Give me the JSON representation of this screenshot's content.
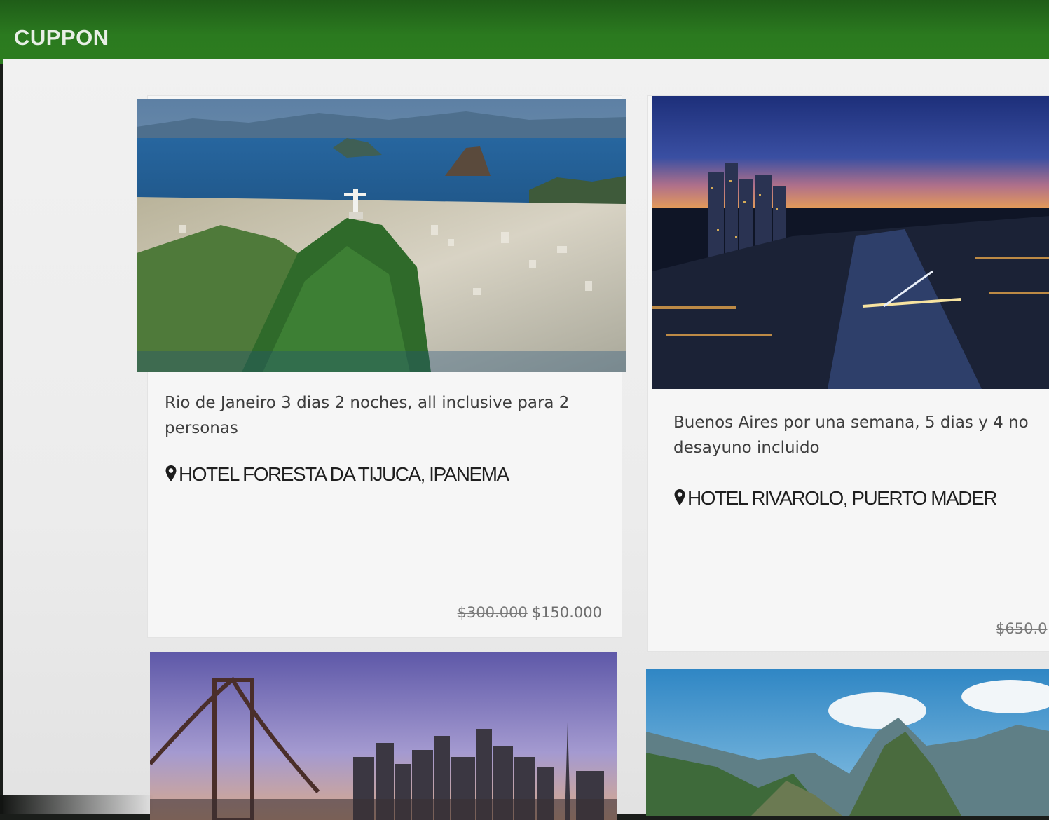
{
  "app": {
    "brand": "CUPPON"
  },
  "cards": [
    {
      "description": "Rio de Janeiro 3 dias 2 noches, all inclusive para 2 personas",
      "location": "HOTEL FORESTA DA TIJUCA, IPANEMA",
      "price_old": "$300.000",
      "price_new": "$150.000",
      "image": "rio-de-janeiro-photo"
    },
    {
      "description": "Buenos Aires por una semana, 5 dias y 4 no desayuno incluido",
      "location": "HOTEL RIVAROLO, PUERTO MADER",
      "price_old": "$650.0",
      "image": "buenos-aires-photo"
    },
    {
      "image": "san-francisco-photo"
    },
    {
      "image": "machu-picchu-photo"
    }
  ],
  "icons": {
    "location": "map-pin-icon"
  },
  "colors": {
    "header": "#2b7a1f",
    "background": "#efefef",
    "text": "#3d3d3d"
  }
}
